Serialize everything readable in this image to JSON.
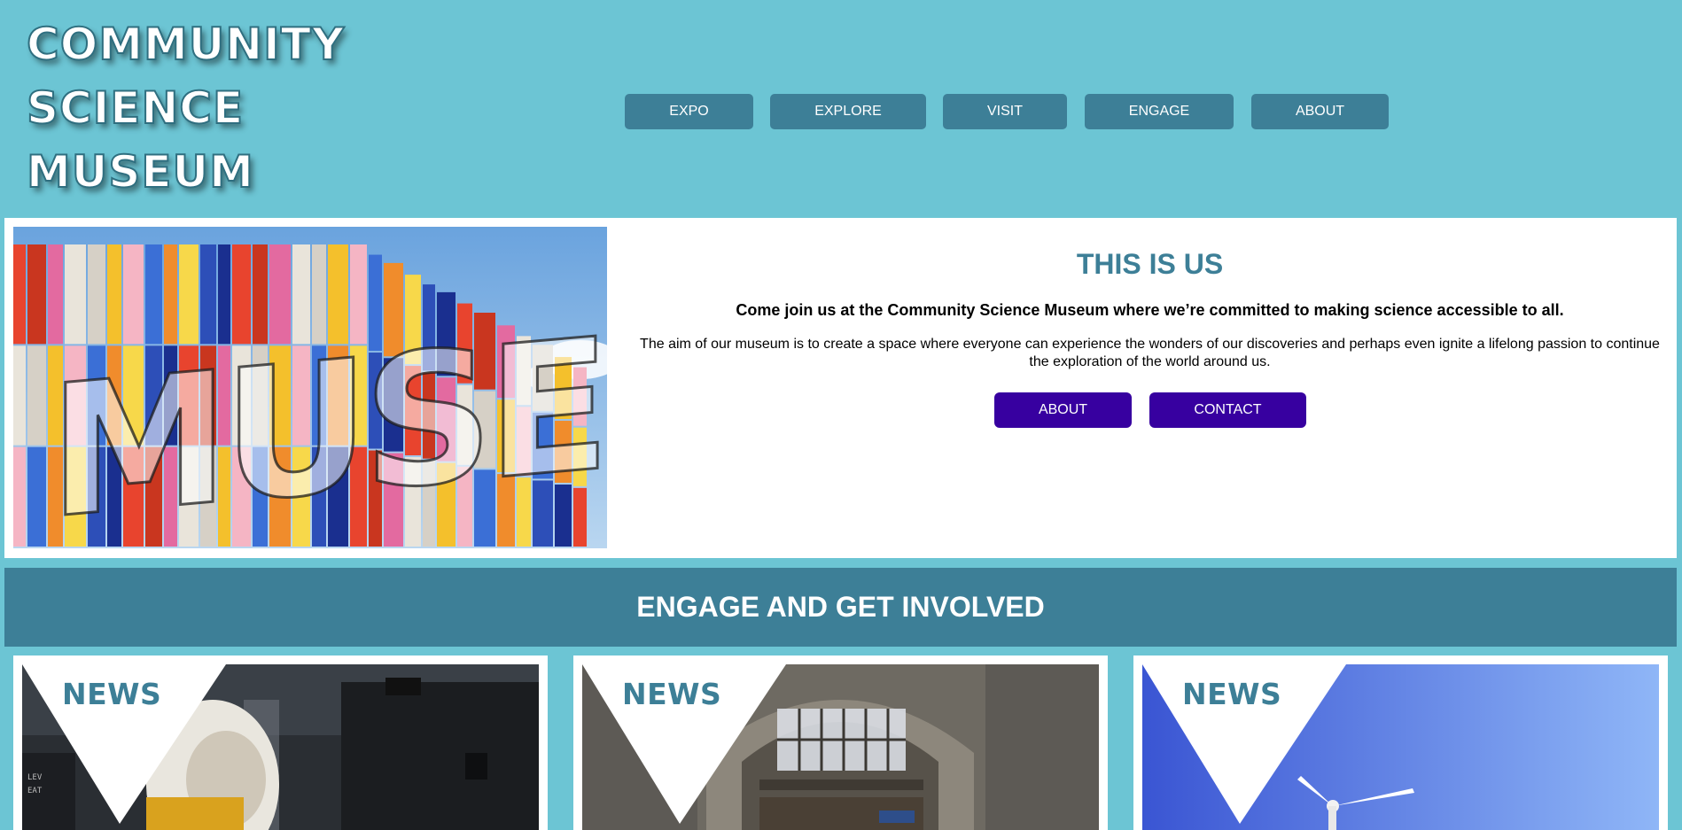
{
  "logo": {
    "lines": [
      "COMMUNITY",
      "SCIENCE",
      "MUSEUM"
    ]
  },
  "nav": {
    "items": [
      "EXPO",
      "EXPLORE",
      "VISIT",
      "ENGAGE",
      "ABOUT"
    ]
  },
  "hero": {
    "title": "THIS IS US",
    "lead": "Come join us at the Community Science Museum where we’re committed to making science accessible to all.",
    "description": "The aim of our museum is to create a space where everyone can experience the wonders of our discoveries and perhaps even ignite a lifelong passion to continue the exploration of the world around us.",
    "buttons": [
      "ABOUT",
      "CONTACT"
    ],
    "image_sign_text": "MUSEUM"
  },
  "engage": {
    "title": "ENGAGE AND GET INVOLVED"
  },
  "cards": [
    {
      "label": "NEWS"
    },
    {
      "label": "NEWS"
    },
    {
      "label": "NEWS"
    }
  ],
  "colors": {
    "page_bg": "#6cc5d4",
    "nav_button": "#3d7f97",
    "cta_button": "#3700a0",
    "heading": "#3d7f97"
  }
}
